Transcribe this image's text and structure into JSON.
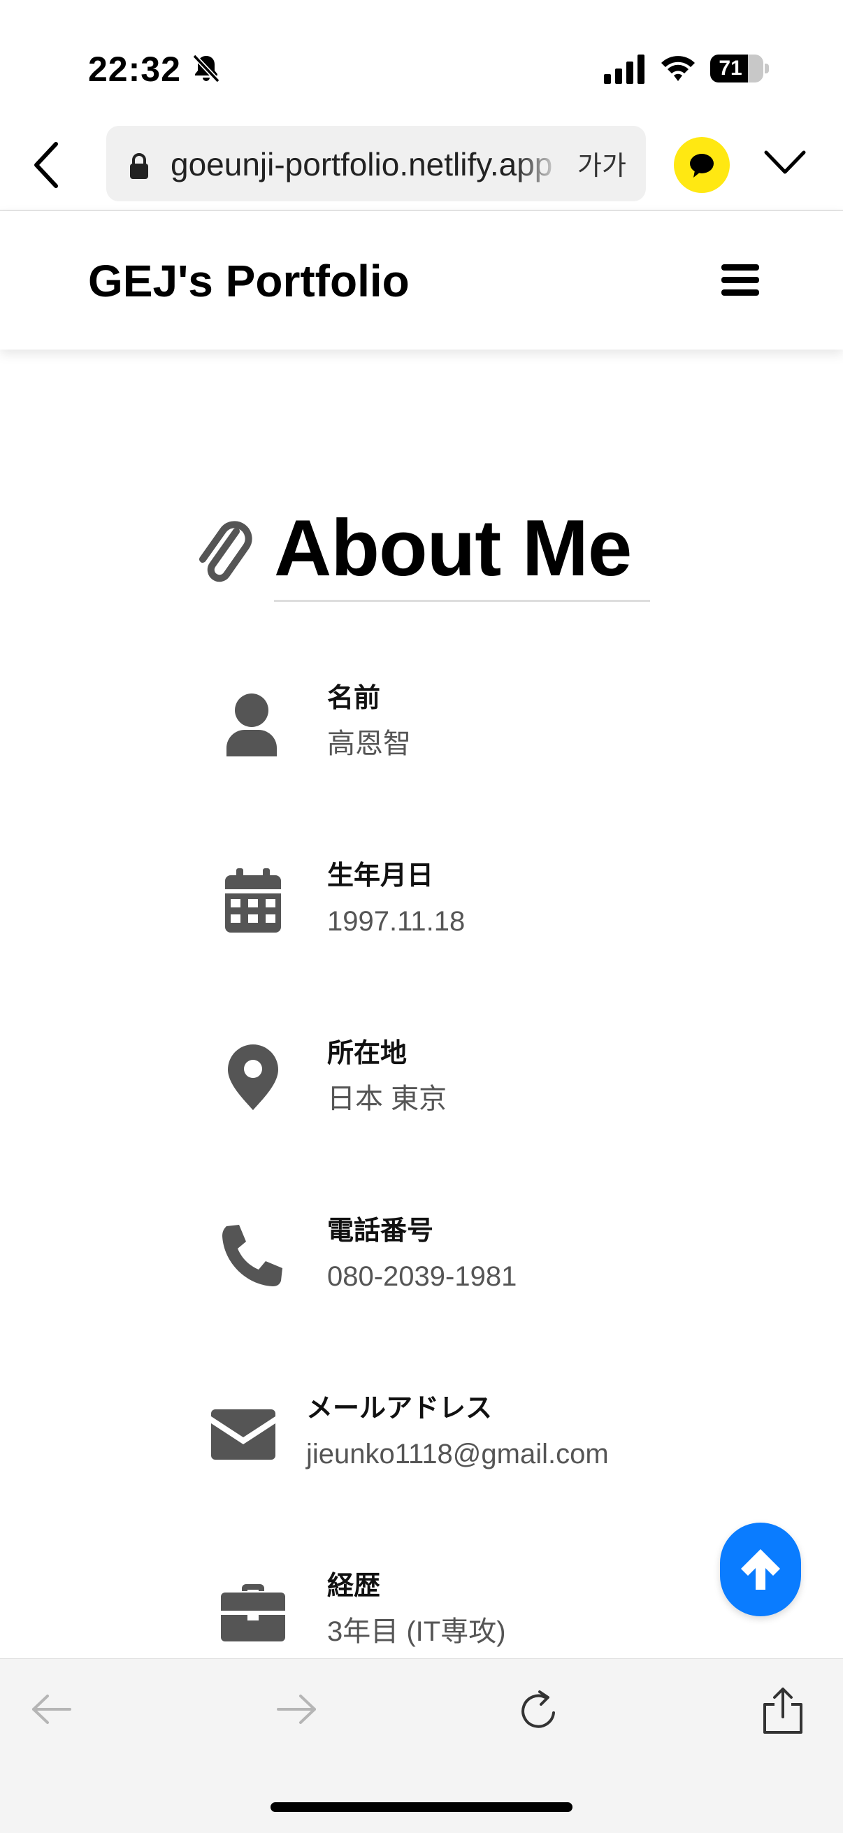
{
  "status_bar": {
    "time": "22:32",
    "battery_level": "71",
    "battery_fraction": 0.71
  },
  "browser": {
    "url": "goeunji-portfolio.netlify.app",
    "text_size_label": "가가"
  },
  "site": {
    "title": "GEJ's Portfolio"
  },
  "about": {
    "heading": "About Me",
    "items": [
      {
        "icon": "user-icon",
        "label": "名前",
        "value": "高恩智"
      },
      {
        "icon": "calendar-icon",
        "label": "生年月日",
        "value": "1997.11.18"
      },
      {
        "icon": "map-marker-icon",
        "label": "所在地",
        "value": "日本 東京"
      },
      {
        "icon": "phone-icon",
        "label": "電話番号",
        "value": "080-2039-1981"
      },
      {
        "icon": "envelope-icon",
        "label": "メールアドレス",
        "value": "jieunko1118@gmail.com"
      },
      {
        "icon": "briefcase-icon",
        "label": "経歴",
        "value": "3年目 (IT専攻)"
      }
    ]
  },
  "colors": {
    "accent": "#0a7cff",
    "kakao": "#ffe812",
    "icon_gray": "#555555"
  }
}
